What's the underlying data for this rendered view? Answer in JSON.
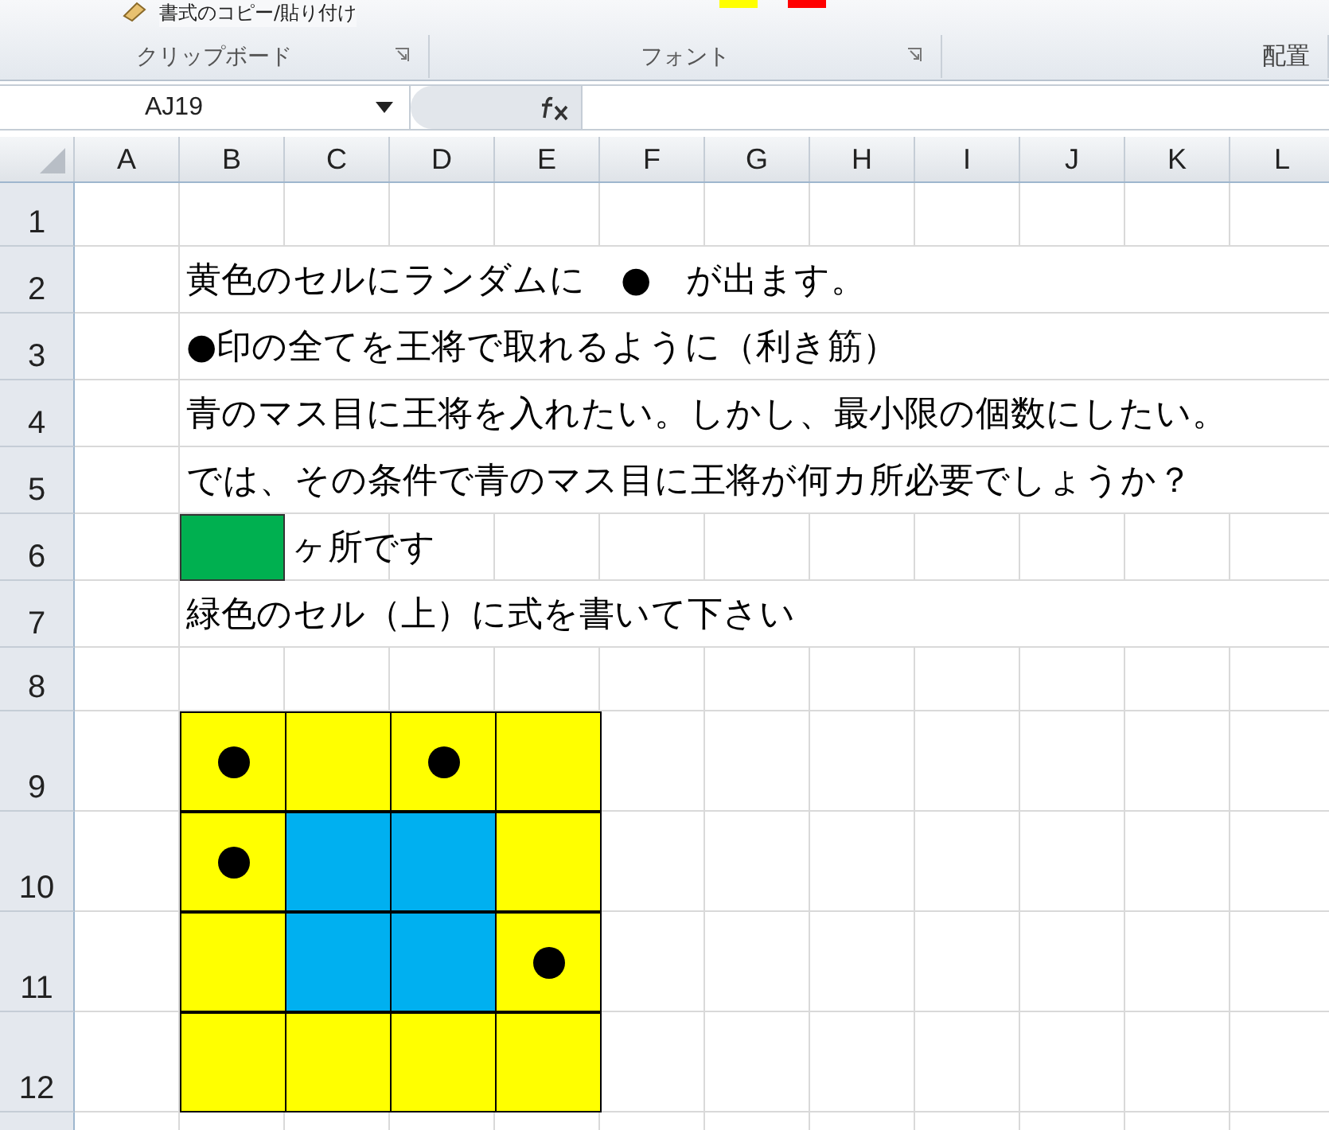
{
  "ribbon": {
    "clipboard_command": "書式のコピー/貼り付け",
    "font_swatches": [
      {
        "color": "#ffff00"
      },
      {
        "color": "#ff0000"
      }
    ],
    "groups": [
      {
        "label": "クリップボード",
        "launcher": true
      },
      {
        "label": "フォント",
        "launcher": true
      },
      {
        "label": "配置",
        "launcher": false
      }
    ]
  },
  "formula_bar": {
    "name_box": "AJ19"
  },
  "columns": [
    "A",
    "B",
    "C",
    "D",
    "E",
    "F",
    "G",
    "H",
    "I",
    "J",
    "K",
    "L"
  ],
  "rows": [
    {
      "header": "1",
      "kind": "blank"
    },
    {
      "header": "2",
      "kind": "text",
      "text": "黄色のセルにランダムに　●　が出ます。"
    },
    {
      "header": "3",
      "kind": "text",
      "text": "●印の全てを王将で取れるように（利き筋）"
    },
    {
      "header": "4",
      "kind": "text",
      "text": "青のマス目に王将を入れたい。しかし、最小限の個数にしたい。"
    },
    {
      "header": "5",
      "kind": "text",
      "text": "では、その条件で青のマス目に王将が何カ所必要でしょうか？"
    },
    {
      "header": "6",
      "kind": "answer",
      "color": "#00b050",
      "text": "ヶ所です"
    },
    {
      "header": "7",
      "kind": "text",
      "text": "緑色のセル（上）に式を書いて下さい"
    },
    {
      "header": "8",
      "kind": "blank"
    },
    {
      "header": "9",
      "kind": "board",
      "cells": [
        {
          "color": "#ffff00",
          "dot": true
        },
        {
          "color": "#ffff00",
          "dot": false
        },
        {
          "color": "#ffff00",
          "dot": true
        },
        {
          "color": "#ffff00",
          "dot": false
        }
      ]
    },
    {
      "header": "10",
      "kind": "board",
      "cells": [
        {
          "color": "#ffff00",
          "dot": true
        },
        {
          "color": "#00b0f0",
          "dot": false
        },
        {
          "color": "#00b0f0",
          "dot": false
        },
        {
          "color": "#ffff00",
          "dot": false
        }
      ]
    },
    {
      "header": "11",
      "kind": "board",
      "cells": [
        {
          "color": "#ffff00",
          "dot": false
        },
        {
          "color": "#00b0f0",
          "dot": false
        },
        {
          "color": "#00b0f0",
          "dot": false
        },
        {
          "color": "#ffff00",
          "dot": true
        }
      ]
    },
    {
      "header": "12",
      "kind": "board",
      "cells": [
        {
          "color": "#ffff00",
          "dot": false
        },
        {
          "color": "#ffff00",
          "dot": false
        },
        {
          "color": "#ffff00",
          "dot": false
        },
        {
          "color": "#ffff00",
          "dot": false
        }
      ]
    }
  ]
}
